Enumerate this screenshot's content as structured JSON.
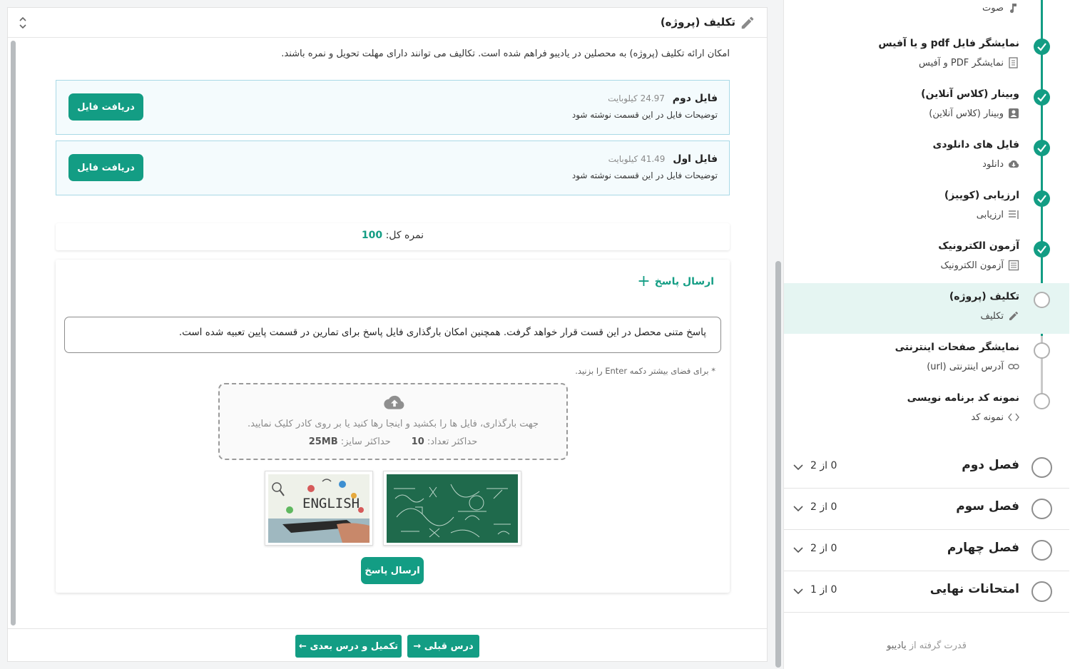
{
  "header": {
    "title": "تکلیف (پروژه)"
  },
  "description": "امکان ارائه تکلیف (پروژه) به محصلین در یادیبو فراهم شده است. تکالیف می توانند دارای مهلت تحویل و نمره باشند.",
  "files": [
    {
      "name": "فایل دوم",
      "size": "24.97 کیلوبایت",
      "desc": "توضیحات فایل در این قسمت نوشته شود",
      "button": "دریافت فایل"
    },
    {
      "name": "فایل اول",
      "size": "41.49 کیلوبایت",
      "desc": "توضیحات فایل در این قسمت نوشته شود",
      "button": "دریافت فایل"
    }
  ],
  "score": {
    "label": "نمره کل:",
    "value": "100"
  },
  "answer": {
    "toggle_label": "ارسال پاسخ",
    "text": "پاسخ متنی محصل در این قست قرار خواهد گرفت. همچنین امکان بارگذاری فایل پاسخ برای تمارین در قسمت پایین تعبیه شده است.",
    "hint": "* برای فضای بیشتر دکمه Enter را بزنید.",
    "dropzone_text": "جهت بارگذاری، فایل ها را بکشید و اینجا رها کنید یا بر روی کادر کلیک نمایید.",
    "max_count_label": "حداکثر تعداد:",
    "max_count": "10",
    "max_size_label": "حداکثر سایز:",
    "max_size": "25MB",
    "thumb_english_text": "ENGLISH",
    "submit": "ارسال پاسخ"
  },
  "footer": {
    "prev": "درس قبلی",
    "next": "تکمیل و درس بعدی"
  },
  "sidebar": {
    "lessons": [
      {
        "title": "",
        "sub": "صوت",
        "icon": "music-icon",
        "status": "done"
      },
      {
        "title": "نمایشگر فایل pdf و یا آفیس",
        "sub": "نمایشگر PDF و آفیس",
        "icon": "document-icon",
        "status": "done"
      },
      {
        "title": "وبینار (کلاس آنلاین)",
        "sub": "وبینار (کلاس آنلاین)",
        "icon": "webinar-icon",
        "status": "done"
      },
      {
        "title": "فایل های دانلودی",
        "sub": "دانلود",
        "icon": "cloud-download-icon",
        "status": "done"
      },
      {
        "title": "ارزیابی (کوییز)",
        "sub": "ارزیابی",
        "icon": "list-icon",
        "status": "done"
      },
      {
        "title": "آزمون الکترونیک",
        "sub": "آزمون الکترونیک",
        "icon": "exam-icon",
        "status": "done"
      },
      {
        "title": "تکلیف (پروژه)",
        "sub": "تکلیف",
        "icon": "pencil-icon",
        "status": "active"
      },
      {
        "title": "نمایشگر صفحات اینترنتی",
        "sub": "آدرس اینترنتی (url)",
        "icon": "link-icon",
        "status": "todo"
      },
      {
        "title": "نمونه کد برنامه نویسی",
        "sub": "نمونه کد",
        "icon": "code-icon",
        "status": "todo"
      }
    ],
    "chapters": [
      {
        "title": "فصل دوم",
        "count": "0 از 2"
      },
      {
        "title": "فصل سوم",
        "count": "0 از 2"
      },
      {
        "title": "فصل چهارم",
        "count": "0 از 2"
      },
      {
        "title": "امتحانات نهایی",
        "count": "0 از 1"
      }
    ],
    "powered_prefix": "قدرت گرفته از",
    "powered_brand": "یادیبو"
  },
  "colors": {
    "accent": "#139d84",
    "active_bg": "#e5f5f2",
    "file_box_bg": "#f4fbfd",
    "file_box_border": "#a9d9e6"
  }
}
